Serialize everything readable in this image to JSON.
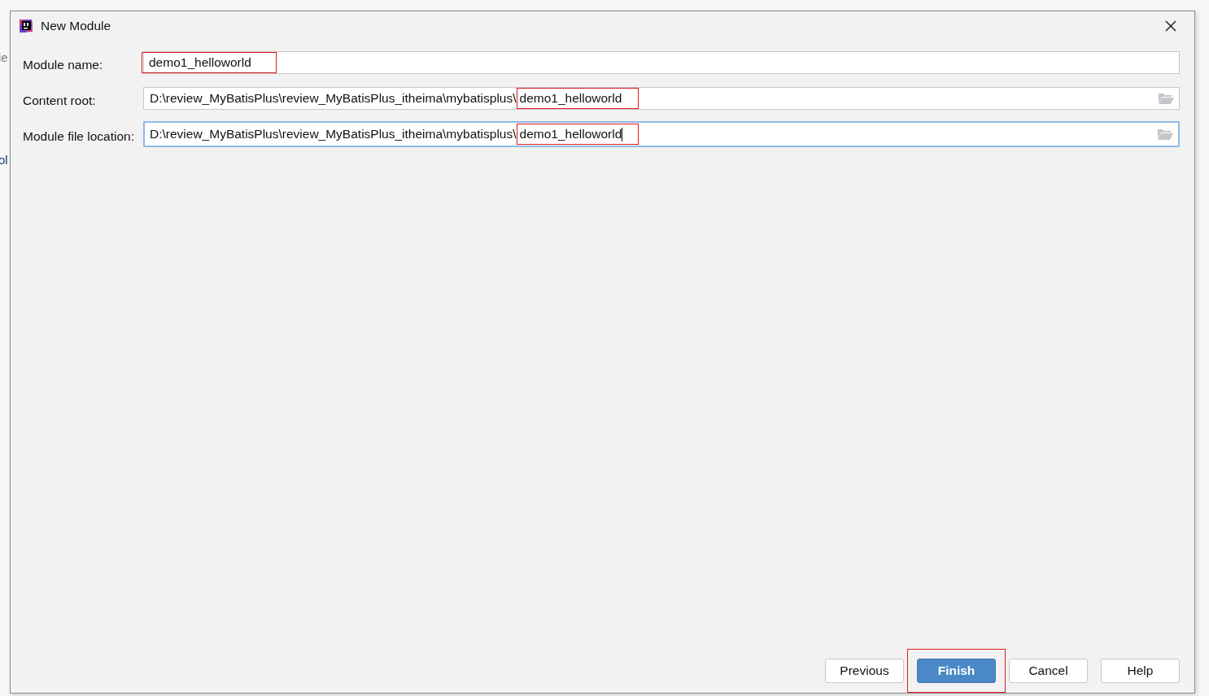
{
  "background_fragments": [
    "ie",
    "ol"
  ],
  "window": {
    "title": "New Module"
  },
  "fields": [
    {
      "label": "Module name:",
      "focused": false,
      "browse": false,
      "value_parts": [
        {
          "text": "demo1_helloworld",
          "annotated": true
        }
      ]
    },
    {
      "label": "Content root:",
      "focused": false,
      "browse": true,
      "value_parts": [
        {
          "text": "D:\\review_MyBatisPlus\\review_MyBatisPlus_itheima\\mybatisplus\\",
          "annotated": false
        },
        {
          "text": "demo1_helloworld",
          "annotated": true
        }
      ]
    },
    {
      "label": "Module file location:",
      "focused": true,
      "browse": true,
      "value_parts": [
        {
          "text": "D:\\review_MyBatisPlus\\review_MyBatisPlus_itheima\\mybatisplus\\",
          "annotated": false
        },
        {
          "text": "demo1_helloworld",
          "annotated": true
        }
      ]
    }
  ],
  "buttons": [
    {
      "label": "Previous",
      "kind": "normal",
      "annotated": false
    },
    {
      "label": "Finish",
      "kind": "primary",
      "annotated": true
    },
    {
      "label": "Cancel",
      "kind": "normal",
      "annotated": false
    },
    {
      "label": "Help",
      "kind": "normal",
      "annotated": false
    }
  ]
}
